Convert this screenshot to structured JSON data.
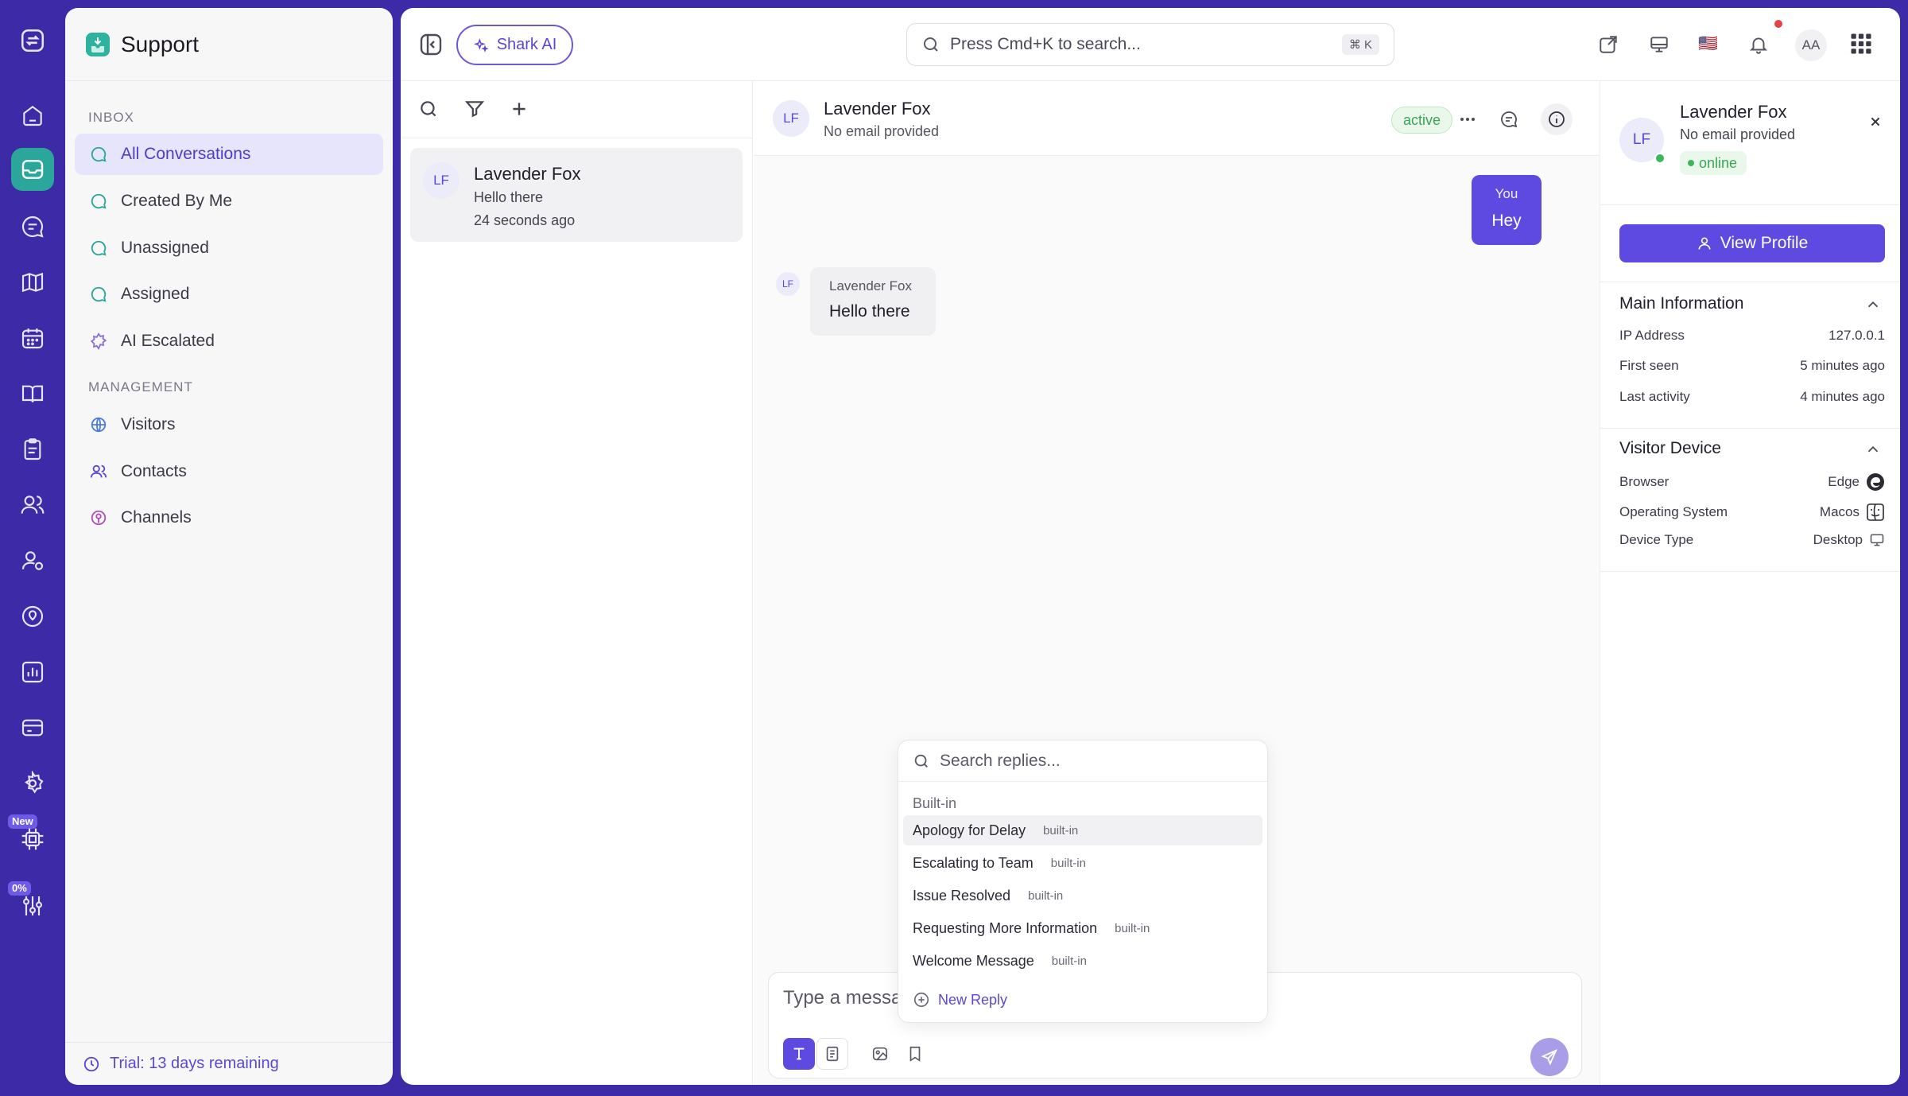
{
  "rail": {
    "new_badge": "New",
    "pct_badge": "0%"
  },
  "sidebar": {
    "title": "Support",
    "inbox_label": "INBOX",
    "management_label": "MANAGEMENT",
    "inbox_items": [
      {
        "label": "All Conversations"
      },
      {
        "label": "Created By Me"
      },
      {
        "label": "Unassigned"
      },
      {
        "label": "Assigned"
      },
      {
        "label": "AI Escalated"
      }
    ],
    "management_items": [
      {
        "label": "Visitors"
      },
      {
        "label": "Contacts"
      },
      {
        "label": "Channels"
      }
    ],
    "trial": "Trial: 13 days remaining"
  },
  "topbar": {
    "shark_ai": "Shark AI",
    "search_placeholder": "Press Cmd+K to search...",
    "search_shortcut": "⌘ K",
    "user_initials": "AA",
    "flag": "🇺🇸"
  },
  "conversation_list": {
    "items": [
      {
        "initials": "LF",
        "name": "Lavender Fox",
        "message": "Hello there",
        "time": "24 seconds ago"
      }
    ]
  },
  "chat": {
    "initials": "LF",
    "name": "Lavender Fox",
    "email": "No email provided",
    "status": "active",
    "messages": [
      {
        "from": "You",
        "text": "Hey"
      },
      {
        "from": "Lavender Fox",
        "initials": "LF",
        "text": "Hello there"
      }
    ],
    "composer_placeholder": "Type a messa"
  },
  "replies": {
    "search_placeholder": "Search replies...",
    "section": "Built-in",
    "items": [
      {
        "label": "Apology for Delay",
        "tag": "built-in"
      },
      {
        "label": "Escalating to Team",
        "tag": "built-in"
      },
      {
        "label": "Issue Resolved",
        "tag": "built-in"
      },
      {
        "label": "Requesting More Information",
        "tag": "built-in"
      },
      {
        "label": "Welcome Message",
        "tag": "built-in"
      }
    ],
    "new_reply": "New Reply"
  },
  "details": {
    "initials": "LF",
    "name": "Lavender Fox",
    "email": "No email provided",
    "status": "online",
    "view_profile": "View Profile",
    "main_info": {
      "title": "Main Information",
      "rows": [
        {
          "label": "IP Address",
          "value": "127.0.0.1"
        },
        {
          "label": "First seen",
          "value": "5 minutes ago"
        },
        {
          "label": "Last activity",
          "value": "4 minutes ago"
        }
      ]
    },
    "device": {
      "title": "Visitor Device",
      "rows": [
        {
          "label": "Browser",
          "value": "Edge"
        },
        {
          "label": "Operating System",
          "value": "Macos"
        },
        {
          "label": "Device Type",
          "value": "Desktop"
        }
      ]
    }
  },
  "colors": {
    "frame": "#3d2aa6",
    "accent": "#5e4ae0",
    "teal": "#2aa69a",
    "online": "#3cb75a"
  }
}
